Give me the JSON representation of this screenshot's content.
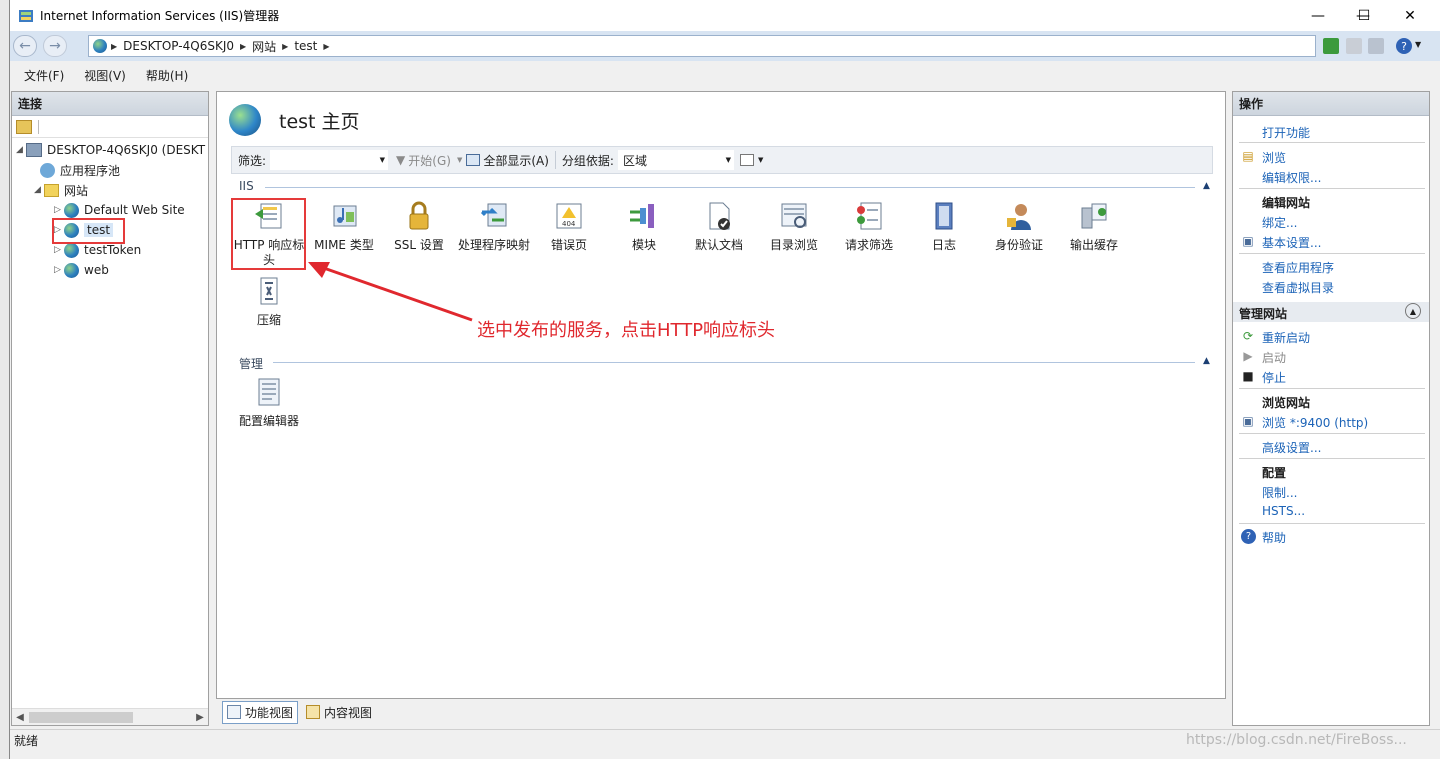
{
  "window": {
    "title": "Internet Information Services (IIS)管理器",
    "min": "—",
    "max": "☐",
    "close": "✕"
  },
  "address": {
    "crumbs": [
      "DESKTOP-4Q6SKJ0",
      "网站",
      "test"
    ]
  },
  "menu": {
    "file": "文件(F)",
    "view": "视图(V)",
    "help": "帮助(H)"
  },
  "connections": {
    "header": "连接",
    "server": "DESKTOP-4Q6SKJ0 (DESKT",
    "apppools": "应用程序池",
    "sites": "网站",
    "site_items": [
      "Default Web Site",
      "test",
      "testToken",
      "web"
    ]
  },
  "main": {
    "title": "test 主页",
    "filter_label": "筛选:",
    "start_label": "开始(G)",
    "show_all_label": "全部显示(A)",
    "group_label": "分组依据:",
    "group_value": "区域",
    "section_iis": "IIS",
    "section_mgmt": "管理",
    "features_iis": [
      "HTTP 响应标头",
      "MIME 类型",
      "SSL 设置",
      "处理程序映射",
      "错误页",
      "模块",
      "默认文档",
      "目录浏览",
      "请求筛选",
      "日志",
      "身份验证",
      "输出缓存",
      "压缩"
    ],
    "features_mgmt": [
      "配置编辑器"
    ],
    "view_features": "功能视图",
    "view_content": "内容视图"
  },
  "actions": {
    "header": "操作",
    "open_feature": "打开功能",
    "browse": "浏览",
    "edit_perms": "编辑权限...",
    "edit_site_group": "编辑网站",
    "bindings": "绑定...",
    "basic_settings": "基本设置...",
    "view_apps": "查看应用程序",
    "view_vdirs": "查看虚拟目录",
    "manage_site_group": "管理网站",
    "restart": "重新启动",
    "start": "启动",
    "stop": "停止",
    "browse_site_group": "浏览网站",
    "browse_http": "浏览 *:9400 (http)",
    "advanced": "高级设置...",
    "config_group": "配置",
    "limits": "限制...",
    "hsts": "HSTS...",
    "help": "帮助"
  },
  "status": {
    "text": "就绪"
  },
  "annotation": {
    "text": "选中发布的服务，点击HTTP响应标头"
  },
  "watermark": "https://blog.csdn.net/FireBoss..."
}
